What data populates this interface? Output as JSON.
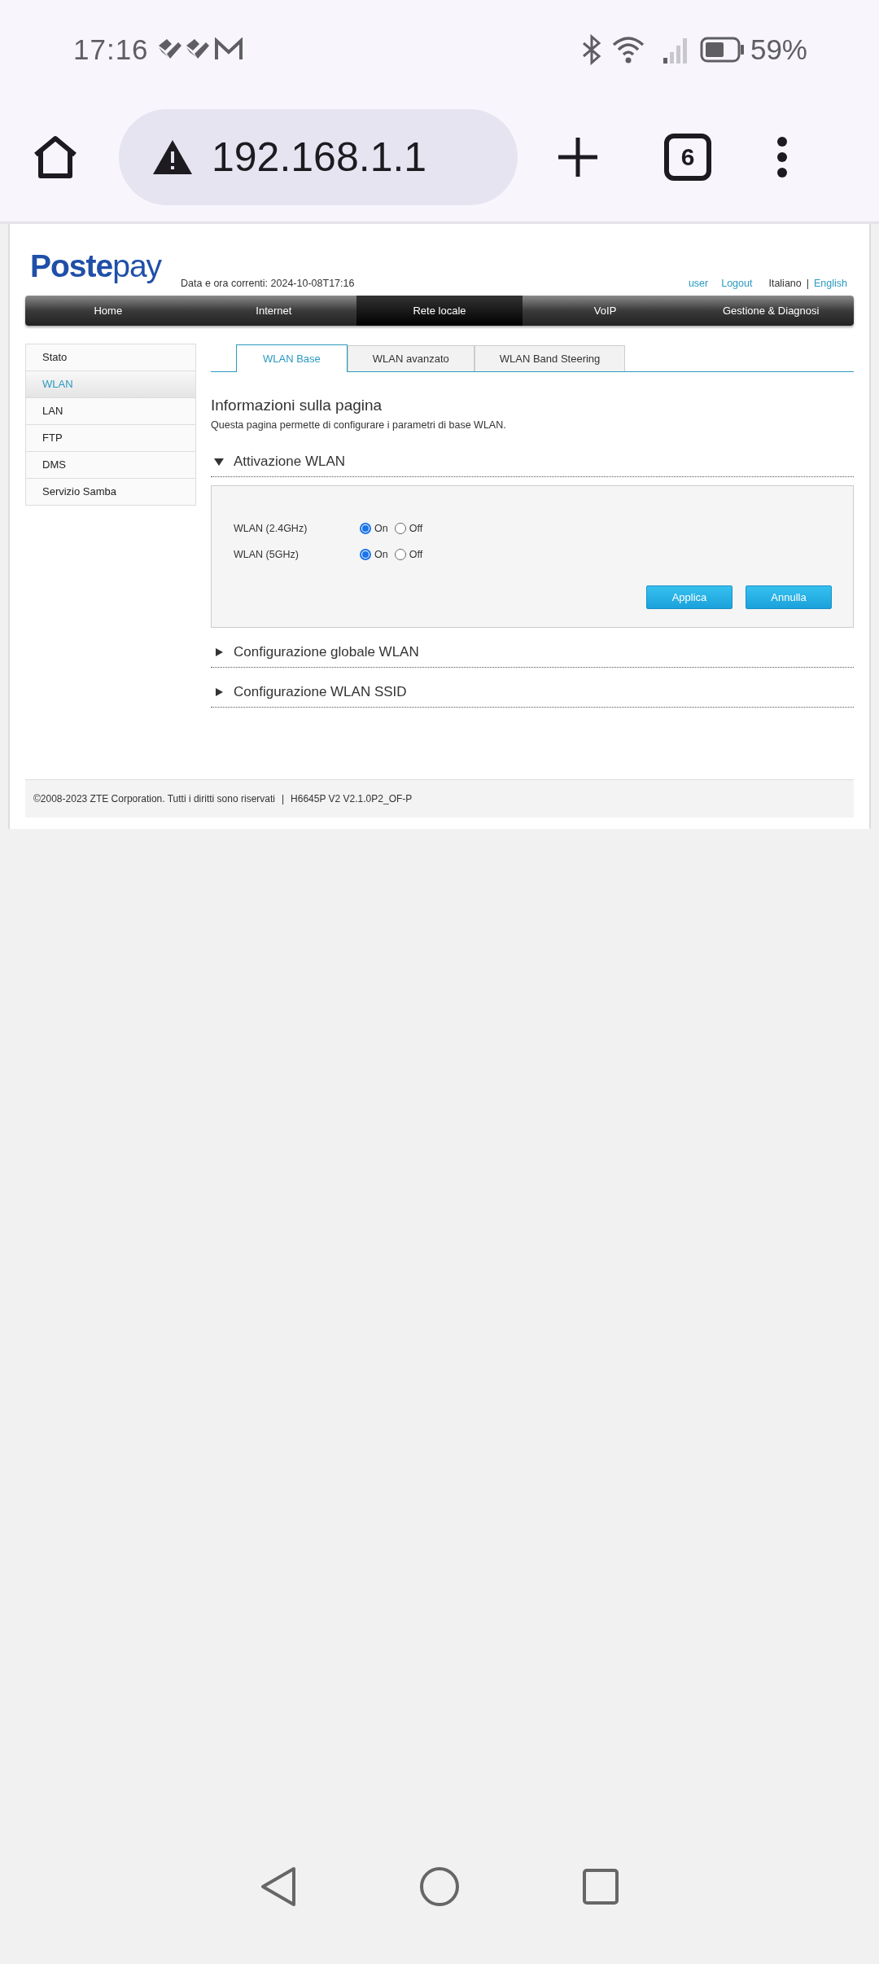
{
  "status_bar": {
    "time": "17:16",
    "battery": "59%"
  },
  "browser": {
    "url": "192.168.1.1",
    "tab_count": "6"
  },
  "router_page": {
    "logo": "**Poste**pay",
    "datetime": "Data e ora correnti: 2024-10-08T17:16",
    "account_links": [
      "user",
      "Logout"
    ],
    "languages": [
      {
        "label": "Italiano",
        "selected": true
      },
      {
        "label": "English",
        "selected": false
      }
    ],
    "language_separator": "|",
    "main_menu": [
      {
        "label": "Home",
        "selected": false
      },
      {
        "label": "Internet",
        "selected": false
      },
      {
        "label": "Rete locale",
        "selected": true
      },
      {
        "label": "VoIP",
        "selected": false
      },
      {
        "label": "Gestione & Diagnosi",
        "selected": false
      }
    ],
    "sidebar": {
      "items": [
        {
          "label": "Stato",
          "selected": false
        },
        {
          "label": "WLAN",
          "selected": true
        },
        {
          "label": "LAN",
          "selected": false
        },
        {
          "label": "FTP",
          "selected": false
        },
        {
          "label": "DMS",
          "selected": false
        },
        {
          "label": "Servizio Samba",
          "selected": false
        }
      ]
    },
    "tabs": [
      {
        "label": "WLAN Base",
        "selected": true
      },
      {
        "label": "WLAN avanzato",
        "selected": false
      },
      {
        "label": "WLAN Band Steering",
        "selected": false
      }
    ],
    "page_title": "Informazioni sulla pagina",
    "page_description": "Questa pagina permette di configurare i parametri di base WLAN.",
    "sections": [
      {
        "title": "Attivazione WLAN",
        "expanded": true,
        "rows": [
          {
            "label": "WLAN (2.4GHz)",
            "options": [
              {
                "label": "On",
                "selected": true
              },
              {
                "label": "Off",
                "selected": false
              }
            ]
          },
          {
            "label": "WLAN (5GHz)",
            "options": [
              {
                "label": "On",
                "selected": true
              },
              {
                "label": "Off",
                "selected": false
              }
            ]
          }
        ],
        "buttons": [
          "Applica",
          "Annulla"
        ]
      },
      {
        "title": "Configurazione globale WLAN",
        "expanded": false
      },
      {
        "title": "Configurazione WLAN SSID",
        "expanded": false
      }
    ],
    "footer": {
      "copyright": "©2008-2023 ZTE Corporation. Tutti i diritti sono riservati",
      "separator": "|",
      "version": "H6645P V2 V2.1.0P2_OF-P"
    }
  }
}
